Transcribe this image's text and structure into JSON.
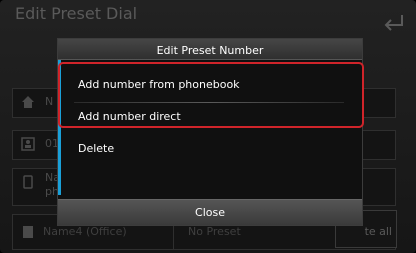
{
  "screen": {
    "title": "Edit Preset Dial",
    "bg_rows": [
      "N",
      "01",
      "Na",
      "ph"
    ],
    "bottom_row": {
      "name": "Name4 (Office)",
      "preset": "No Preset"
    },
    "delete_all_label": "te all"
  },
  "dialog": {
    "title": "Edit Preset Number",
    "options": [
      "Add number from phonebook",
      "Add number direct",
      "Delete"
    ],
    "close_label": "Close"
  },
  "colors": {
    "accent": "#1aa0d8",
    "highlight": "#d0242a"
  }
}
